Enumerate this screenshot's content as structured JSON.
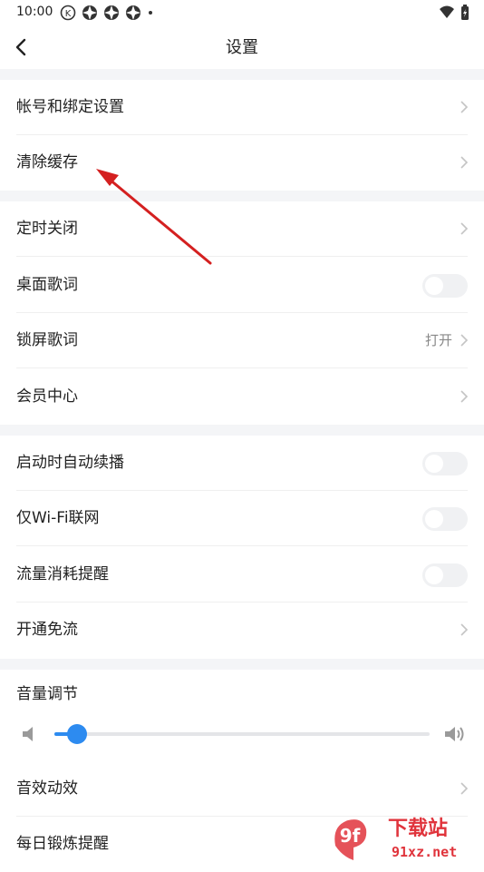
{
  "status_bar": {
    "time": "10:00",
    "k_icon": "K"
  },
  "header": {
    "title": "设置"
  },
  "sections": {
    "account": [
      {
        "id": "account-binding",
        "label": "帐号和绑定设置"
      },
      {
        "id": "clear-cache",
        "label": "清除缓存"
      }
    ],
    "playback": {
      "timer": "定时关闭",
      "desktop_lyrics": "桌面歌词",
      "lock_lyrics": "锁屏歌词",
      "lock_lyrics_value": "打开",
      "vip": "会员中心"
    },
    "network": {
      "auto_play": "启动时自动续播",
      "wifi_only": "仅Wi-Fi联网",
      "traffic_remind": "流量消耗提醒",
      "free_flow": "开通免流"
    },
    "audio": {
      "volume": "音量调节",
      "volume_level": 0.06,
      "sound_effect": "音效动效",
      "exercise": "每日锻炼提醒"
    }
  },
  "toggles": {
    "desktop_lyrics": false,
    "auto_play": false,
    "wifi_only": false,
    "traffic_remind": false
  },
  "watermark": {
    "logo": "9f",
    "text_cn": "下载站",
    "text_url": "91xz.net"
  },
  "colors": {
    "accent": "#2d8bf0",
    "annotation_arrow": "#d42020",
    "section_gap": "#f4f5f7"
  }
}
